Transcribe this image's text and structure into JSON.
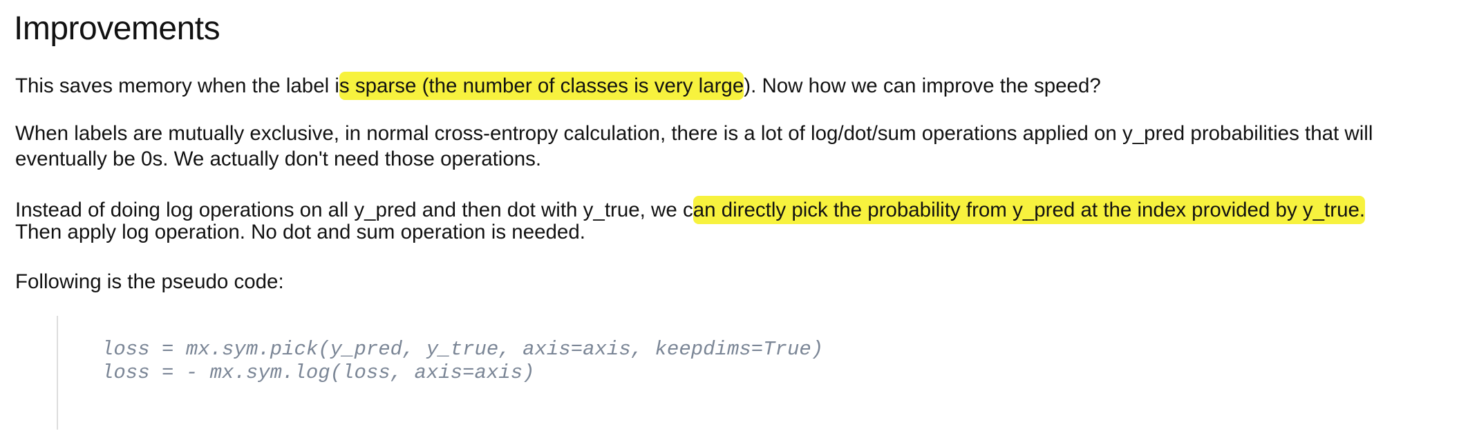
{
  "heading": "Improvements",
  "p1": {
    "before": "This saves memory when the label i",
    "highlight": "s sparse (the number of classes is very large",
    "after": "). Now how we can improve the speed?"
  },
  "p2": {
    "line1": "When labels are mutually exclusive, in normal cross-entropy calculation, there is a lot of log/dot/sum operations applied on y_pred probabilities that will",
    "line2": "eventually be 0s. We actually don't need those operations."
  },
  "p3": {
    "before": "Instead of doing log operations on all y_pred and then dot with y_true, we c",
    "highlight": "an directly pick the probability from y_pred at the index provided by y_true.",
    "line2": "Then apply log operation. No dot and sum operation is needed."
  },
  "p4": "Following is the pseudo code:",
  "code": [
    "loss = mx.sym.pick(y_pred, y_true, axis=axis, keepdims=True)",
    "loss = - mx.sym.log(loss, axis=axis)"
  ],
  "colors": {
    "highlight": "#f7f23e",
    "code_text": "#7b8696"
  }
}
